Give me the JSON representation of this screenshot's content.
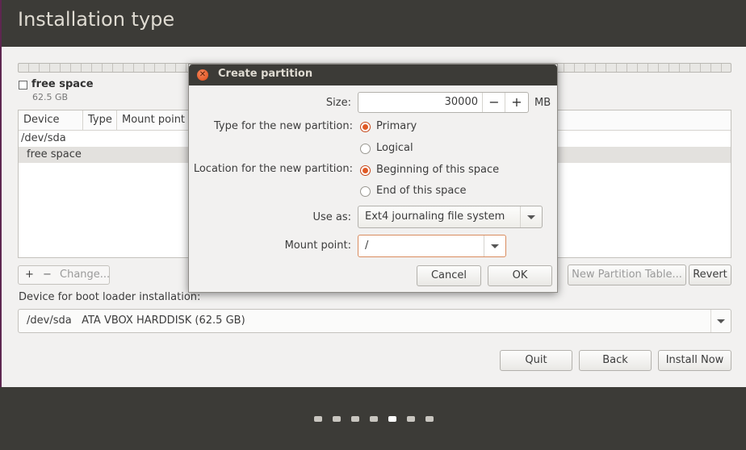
{
  "header": {
    "title": "Installation type"
  },
  "legend": {
    "name": "free space",
    "size": "62.5 GB"
  },
  "table": {
    "columns": [
      "Device",
      "Type",
      "Mount point"
    ],
    "rows": [
      "/dev/sda",
      "free space"
    ]
  },
  "toolbar": {
    "add": "+",
    "remove": "−",
    "change": "Change...",
    "new_table": "New Partition Table...",
    "revert": "Revert"
  },
  "bootloader": {
    "label": "Device for boot loader installation:",
    "device": "/dev/sda",
    "description": "ATA VBOX HARDDISK (62.5 GB)"
  },
  "actions": {
    "quit": "Quit",
    "back": "Back",
    "install": "Install Now"
  },
  "progress": {
    "total_dots": 7,
    "current_step": 5
  },
  "dialog": {
    "title": "Create partition",
    "size_label": "Size:",
    "size_value": "30000",
    "size_unit": "MB",
    "minus": "−",
    "plus": "+",
    "type_label": "Type for the new partition:",
    "type_primary": "Primary",
    "type_logical": "Logical",
    "type_selected": "Primary",
    "location_label": "Location for the new partition:",
    "location_beginning": "Beginning of this space",
    "location_end": "End of this space",
    "location_selected": "Beginning of this space",
    "use_as_label": "Use as:",
    "use_as_value": "Ext4 journaling file system",
    "mount_label": "Mount point:",
    "mount_value": "/",
    "cancel": "Cancel",
    "ok": "OK"
  },
  "colors": {
    "accent": "#e05a26",
    "header_bg": "#3c3b37",
    "window_bg": "#f2f1f0"
  }
}
